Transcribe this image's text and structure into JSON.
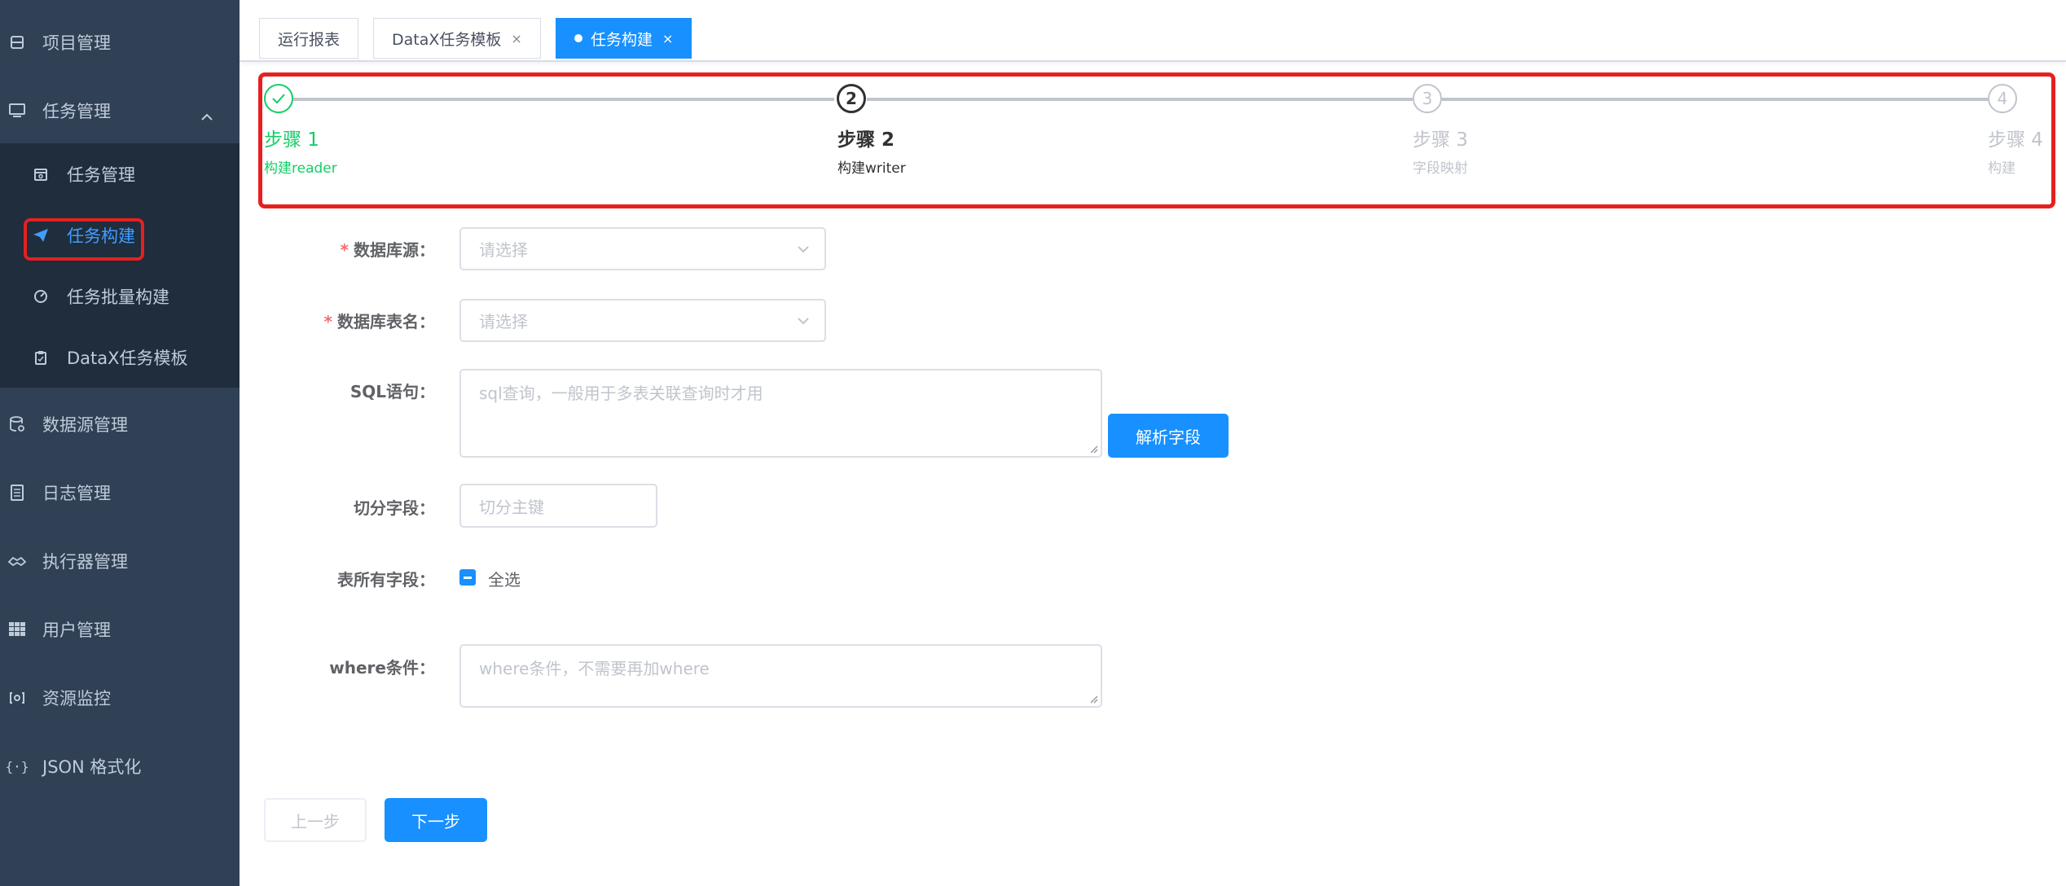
{
  "sidebar": {
    "items": [
      {
        "label": "项目管理",
        "icon": "database-icon"
      },
      {
        "label": "任务管理",
        "icon": "monitor-icon"
      },
      {
        "label": "数据源管理",
        "icon": "datasource-icon"
      },
      {
        "label": "日志管理",
        "icon": "document-icon"
      },
      {
        "label": "执行器管理",
        "icon": "executor-icon"
      },
      {
        "label": "用户管理",
        "icon": "grid-icon"
      },
      {
        "label": "资源监控",
        "icon": "monitor-gauge-icon"
      },
      {
        "label": "JSON 格式化",
        "icon": "braces-icon"
      }
    ],
    "submenu": [
      {
        "label": "任务管理",
        "icon": "calendar-icon"
      },
      {
        "label": "任务构建",
        "icon": "paper-plane-icon"
      },
      {
        "label": "任务批量构建",
        "icon": "dashboard-icon"
      },
      {
        "label": "DataX任务模板",
        "icon": "clipboard-icon"
      }
    ]
  },
  "tags": [
    {
      "label": "运行报表"
    },
    {
      "label": "DataX任务模板",
      "close": "×"
    },
    {
      "label": "任务构建",
      "close": "×"
    }
  ],
  "steps": [
    {
      "title": "步骤 1",
      "desc": "构建reader",
      "status": "done"
    },
    {
      "title": "步骤 2",
      "desc": "构建writer",
      "status": "process",
      "number": "2"
    },
    {
      "title": "步骤 3",
      "desc": "字段映射",
      "status": "wait",
      "number": "3"
    },
    {
      "title": "步骤 4",
      "desc": "构建",
      "status": "wait",
      "number": "4"
    }
  ],
  "form": {
    "datasource": {
      "label": "数据库源：",
      "placeholder": "请选择"
    },
    "table": {
      "label": "数据库表名：",
      "placeholder": "请选择"
    },
    "sql": {
      "label": "SQL语句：",
      "placeholder": "sql查询，一般用于多表关联查询时才用"
    },
    "parse_button": "解析字段",
    "split": {
      "label": "切分字段：",
      "placeholder": "切分主键"
    },
    "all_fields": {
      "label": "表所有字段：",
      "checkbox_label": "全选"
    },
    "where": {
      "label": "where条件：",
      "placeholder": "where条件，不需要再加where"
    }
  },
  "buttons": {
    "prev": "上一步",
    "next": "下一步"
  },
  "colors": {
    "primary": "#1890ff",
    "sidebar": "#304156",
    "submenu": "#1f2d3d",
    "done": "#13ce66",
    "highlight": "#e62020"
  }
}
